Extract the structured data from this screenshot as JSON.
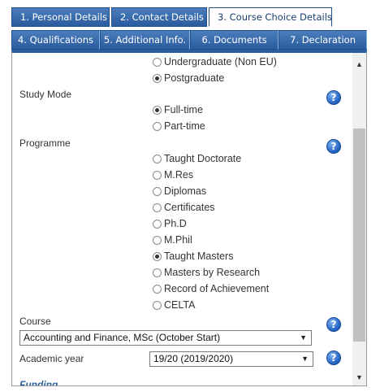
{
  "tabs_row1": [
    {
      "label": "1. Personal Details"
    },
    {
      "label": "2. Contact Details"
    },
    {
      "label": "3. Course Choice Details"
    }
  ],
  "tabs_row2": [
    {
      "label": "4. Qualifications"
    },
    {
      "label": "5. Additional Info."
    },
    {
      "label": "6. Documents"
    },
    {
      "label": "7. Declaration"
    }
  ],
  "active_tab": "3. Course Choice Details",
  "fee_status": {
    "options": [
      {
        "label": "Undergraduate (Non EU)",
        "selected": false
      },
      {
        "label": "Postgraduate",
        "selected": true
      }
    ]
  },
  "study_mode": {
    "label": "Study Mode",
    "options": [
      {
        "label": "Full-time",
        "selected": true
      },
      {
        "label": "Part-time",
        "selected": false
      }
    ]
  },
  "programme": {
    "label": "Programme",
    "options": [
      {
        "label": "Taught Doctorate",
        "selected": false
      },
      {
        "label": "M.Res",
        "selected": false
      },
      {
        "label": "Diplomas",
        "selected": false
      },
      {
        "label": "Certificates",
        "selected": false
      },
      {
        "label": "Ph.D",
        "selected": false
      },
      {
        "label": "M.Phil",
        "selected": false
      },
      {
        "label": "Taught Masters",
        "selected": true
      },
      {
        "label": "Masters by Research",
        "selected": false
      },
      {
        "label": "Record of Achievement",
        "selected": false
      },
      {
        "label": "CELTA",
        "selected": false
      }
    ]
  },
  "course": {
    "label": "Course",
    "value": "Accounting and Finance, MSc (October Start)"
  },
  "academic_year": {
    "label": "Academic year",
    "value": "19/20 (2019/2020)"
  },
  "funding": {
    "label": "Funding"
  },
  "icons": {
    "help": "?",
    "dropdown_arrow": "▼",
    "scroll_up": "▲",
    "scroll_down": "▼"
  },
  "colors": {
    "tab_blue": "#2a5c9e",
    "help_blue": "#1f5fbf"
  }
}
